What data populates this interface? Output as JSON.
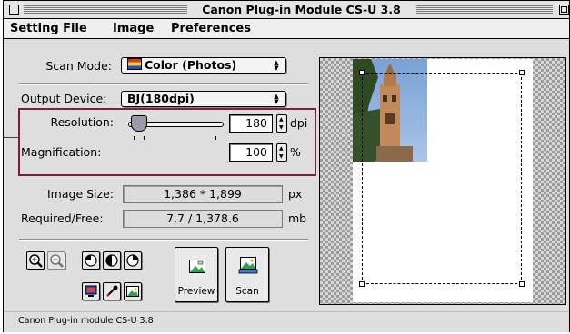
{
  "window": {
    "title": "Canon Plug-in Module CS-U 3.8"
  },
  "menubar": {
    "items": [
      "Setting File",
      "Image",
      "Preferences"
    ]
  },
  "scan_mode": {
    "label": "Scan Mode:",
    "value": "Color (Photos)"
  },
  "output_device": {
    "label": "Output Device:",
    "value": "BJ(180dpi)"
  },
  "resolution": {
    "label": "Resolution:",
    "value": "180",
    "unit": "dpi"
  },
  "magnification": {
    "label": "Magnification:",
    "value": "100",
    "unit": "%"
  },
  "image_size": {
    "label": "Image Size:",
    "value": "1,386 * 1,899",
    "unit": "px"
  },
  "required_free": {
    "label": "Required/Free:",
    "value": "7.7 / 1,378.6",
    "unit": "mb"
  },
  "buttons": {
    "preview": "Preview",
    "scan": "Scan"
  },
  "status": {
    "text": "Canon Plug-in module CS-U 3.8"
  },
  "colors": {
    "highlight_box": "#7a1f3c",
    "window_bg": "#dedede"
  },
  "icons": [
    "zoom-in-icon",
    "zoom-out-icon",
    "rotate-left-icon",
    "flip-icon",
    "rotate-right-icon",
    "monitor-icon",
    "eyedropper-icon",
    "image-icon",
    "preview-icon",
    "scan-icon"
  ]
}
